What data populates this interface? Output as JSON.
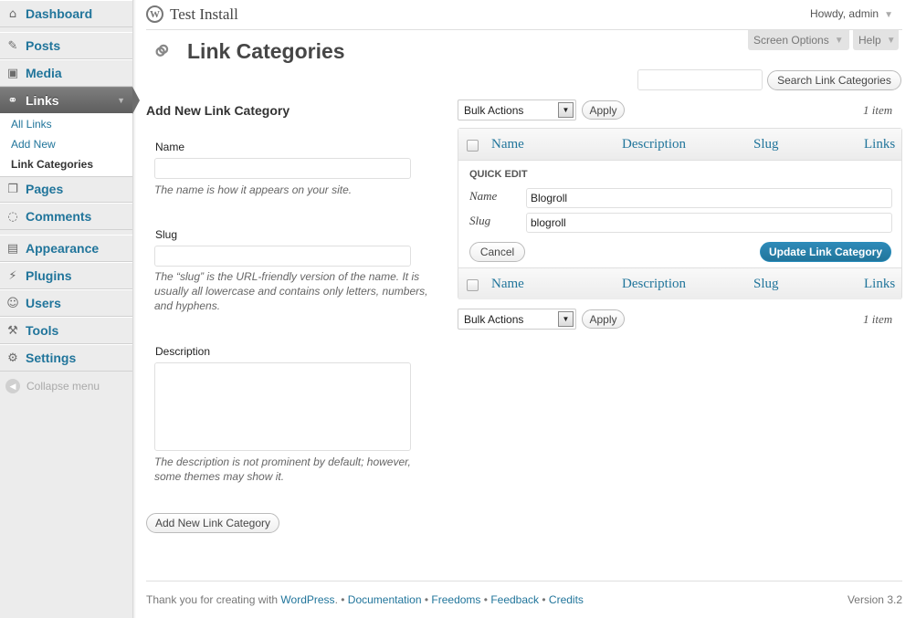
{
  "sidebar": {
    "items": [
      {
        "label": "Dashboard",
        "icon": "dashboard-icon"
      },
      {
        "label": "Posts",
        "icon": "pushpin-icon"
      },
      {
        "label": "Media",
        "icon": "media-icon"
      },
      {
        "label": "Links",
        "icon": "link-icon"
      },
      {
        "label": "Pages",
        "icon": "pages-icon"
      },
      {
        "label": "Comments",
        "icon": "comment-icon"
      },
      {
        "label": "Appearance",
        "icon": "appearance-icon"
      },
      {
        "label": "Plugins",
        "icon": "plugin-icon"
      },
      {
        "label": "Users",
        "icon": "users-icon"
      },
      {
        "label": "Tools",
        "icon": "tools-icon"
      },
      {
        "label": "Settings",
        "icon": "settings-icon"
      }
    ],
    "submenu": [
      "All Links",
      "Add New",
      "Link Categories"
    ],
    "collapse_label": "Collapse menu"
  },
  "header": {
    "site_name": "Test Install",
    "howdy": "Howdy, admin",
    "screen_options": "Screen Options",
    "help": "Help"
  },
  "page": {
    "title": "Link Categories",
    "search_button": "Search Link Categories"
  },
  "form": {
    "heading": "Add New Link Category",
    "name_label": "Name",
    "name_hint": "The name is how it appears on your site.",
    "slug_label": "Slug",
    "slug_hint": "The “slug” is the URL-friendly version of the name. It is usually all lowercase and contains only letters, numbers, and hyphens.",
    "description_label": "Description",
    "description_hint": "The description is not prominent by default; however, some themes may show it.",
    "submit": "Add New Link Category"
  },
  "list": {
    "bulk_actions": "Bulk Actions",
    "apply": "Apply",
    "count": "1 item",
    "columns": [
      "Name",
      "Description",
      "Slug",
      "Links"
    ],
    "quick_edit": {
      "title": "QUICK EDIT",
      "name_label": "Name",
      "name_value": "Blogroll",
      "slug_label": "Slug",
      "slug_value": "blogroll",
      "cancel": "Cancel",
      "update": "Update Link Category"
    }
  },
  "footer": {
    "thanks": "Thank you for creating with",
    "links": [
      "WordPress",
      "Documentation",
      "Freedoms",
      "Feedback",
      "Credits"
    ],
    "version": "Version 3.2"
  },
  "colors": {
    "link": "#21759b",
    "current_menu": "#6d6d6d",
    "primary_button": "#21759b"
  }
}
